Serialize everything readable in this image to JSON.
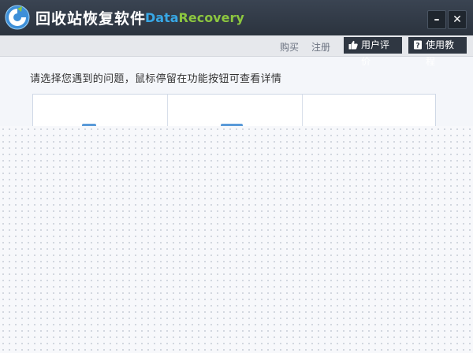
{
  "window": {
    "title": "回收站恢复软件",
    "brand_part1": "Data",
    "brand_part2": "Recovery",
    "minimize_label": "–",
    "close_label": "✕"
  },
  "toolbar": {
    "buy_label": "购买",
    "register_label": "注册",
    "review_label": "用户评价",
    "tutorial_label": "使用教程"
  },
  "main": {
    "prompt": "请选择您遇到的问题，鼠标停留在功能按钮可查看详情"
  },
  "colors": {
    "titlebar": "#2b333e",
    "brand_blue": "#38a8e6",
    "brand_green": "#8cc63f",
    "accent_blue": "#5a9ad8"
  }
}
